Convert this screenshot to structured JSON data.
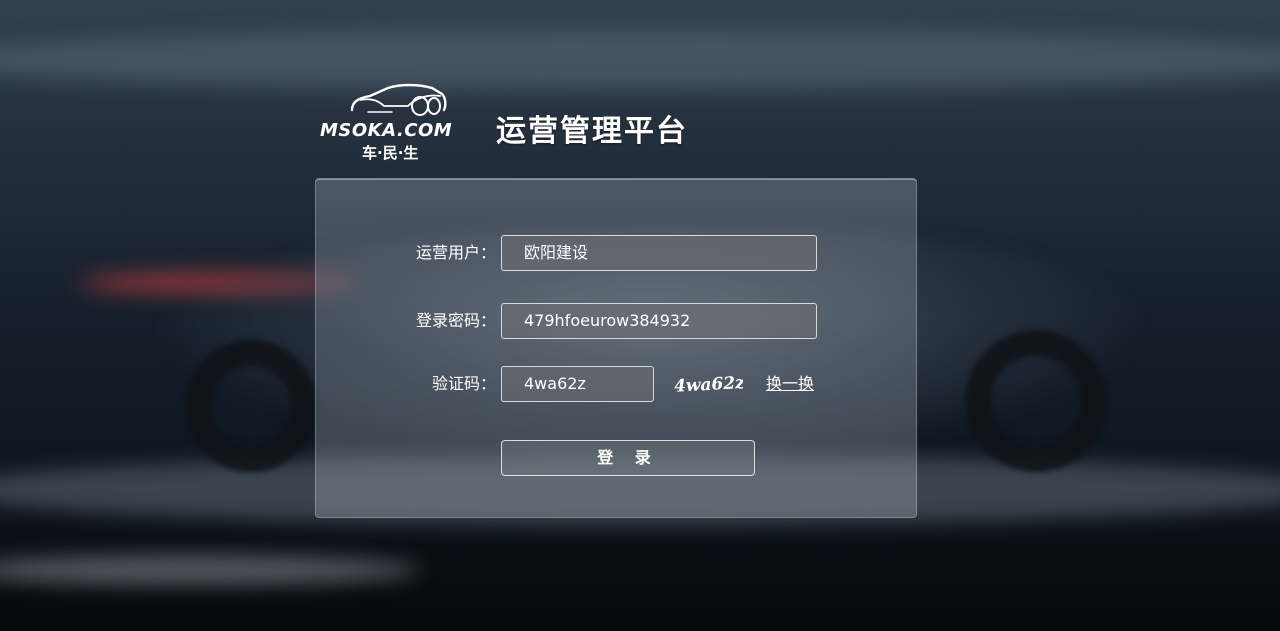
{
  "header": {
    "logo_brand": "MSOKA.COM",
    "logo_sub": "车·民·生",
    "title": "运营管理平台"
  },
  "login_form": {
    "username_label": "运营用户：",
    "username_value": "欧阳建设",
    "password_label": "登录密码：",
    "password_value": "479hfoeurow384932",
    "captcha_label": "验证码：",
    "captcha_value": "4wa62z",
    "captcha_image_text": "4wa62z",
    "refresh_label": "换一换",
    "login_label": "登 录"
  },
  "colors": {
    "text": "#ffffff",
    "background_dark": "#0f1721"
  }
}
